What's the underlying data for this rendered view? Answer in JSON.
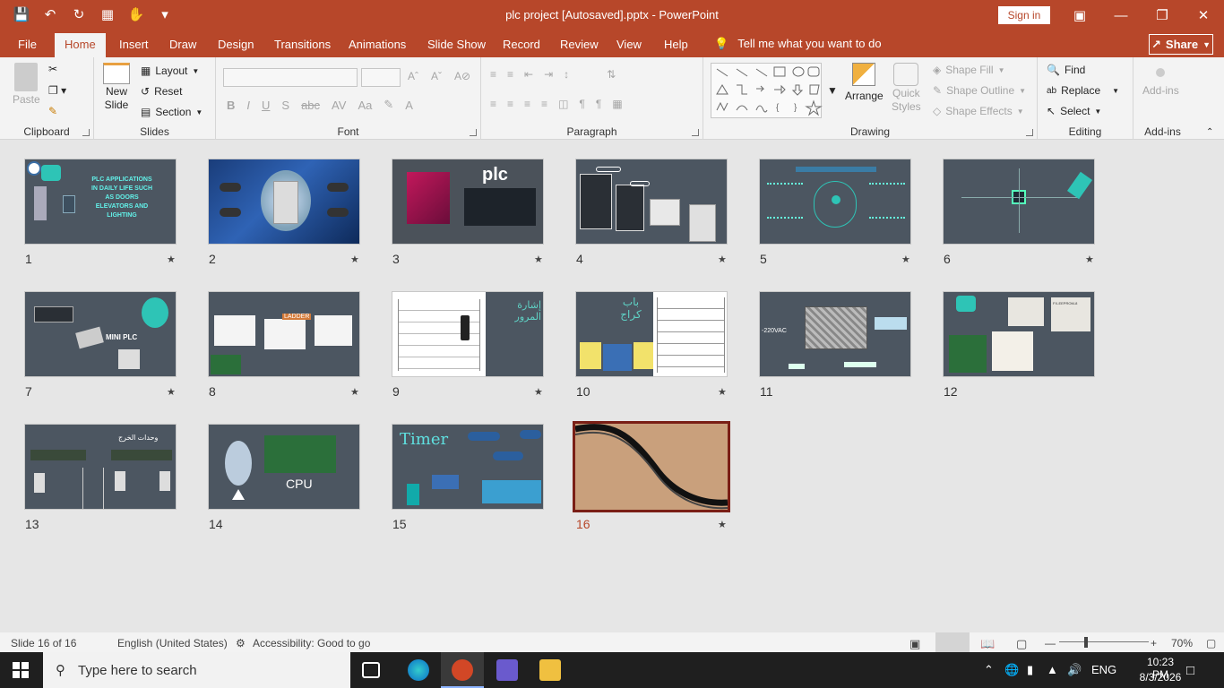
{
  "window": {
    "title": "plc project [Autosaved].pptx  -  PowerPoint",
    "sign_in": "Sign in"
  },
  "tabs": [
    "File",
    "Home",
    "Insert",
    "Draw",
    "Design",
    "Transitions",
    "Animations",
    "Slide Show",
    "Record",
    "Review",
    "View",
    "Help"
  ],
  "active_tab": "Home",
  "tell_me": "Tell me what you want to do",
  "share": "Share",
  "ribbon": {
    "clipboard": {
      "label": "Clipboard",
      "paste": "Paste"
    },
    "slides": {
      "label": "Slides",
      "new_slide_1": "New",
      "new_slide_2": "Slide",
      "layout": "Layout",
      "reset": "Reset",
      "section": "Section"
    },
    "font": {
      "label": "Font"
    },
    "paragraph": {
      "label": "Paragraph"
    },
    "drawing": {
      "label": "Drawing",
      "arrange": "Arrange",
      "quick_1": "Quick",
      "quick_2": "Styles",
      "shape_fill": "Shape Fill",
      "shape_outline": "Shape Outline",
      "shape_effects": "Shape Effects"
    },
    "editing": {
      "label": "Editing",
      "find": "Find",
      "replace": "Replace",
      "select": "Select"
    },
    "addins": {
      "label": "Add-ins",
      "addins": "Add-ins"
    }
  },
  "slides": [
    {
      "num": "1",
      "text": "PLC APPLICATIONS IN DAILY LIFE SUCH AS DOORS ELEVATORS AND LIGHTING"
    },
    {
      "num": "2",
      "text": ""
    },
    {
      "num": "3",
      "text": "plc"
    },
    {
      "num": "4",
      "text": ""
    },
    {
      "num": "5",
      "text": ""
    },
    {
      "num": "6",
      "text": ""
    },
    {
      "num": "7",
      "text": "MINI PLC"
    },
    {
      "num": "8",
      "text": "LADDER"
    },
    {
      "num": "9",
      "text": "إشارة المرور"
    },
    {
      "num": "10",
      "text": "باب كراج"
    },
    {
      "num": "11",
      "text": "-220VAC"
    },
    {
      "num": "12",
      "text": "FX-EEPROM-8"
    },
    {
      "num": "13",
      "text": "وحدات الخرج"
    },
    {
      "num": "14",
      "text": "CPU"
    },
    {
      "num": "15",
      "text": "Timer"
    },
    {
      "num": "16",
      "text": ""
    }
  ],
  "selected_slide": "16",
  "status": {
    "slide_info": "Slide 16 of 16",
    "language": "English (United States)",
    "accessibility": "Accessibility: Good to go",
    "zoom": "70%"
  },
  "taskbar": {
    "search_placeholder": "Type here to search",
    "lang": "ENG",
    "time": "10:23 PM",
    "date": "8/3/2026"
  }
}
